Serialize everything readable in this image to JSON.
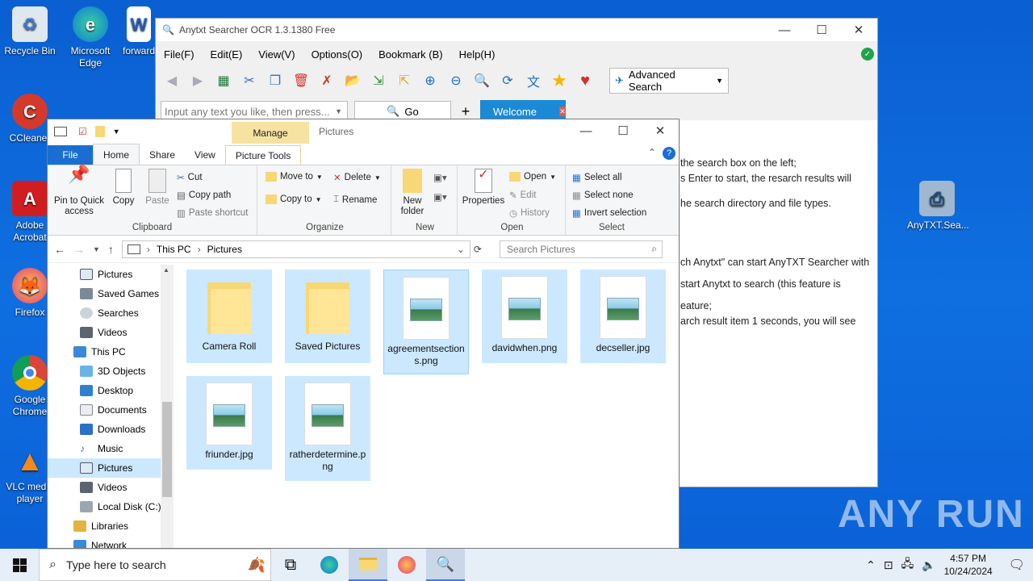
{
  "desktop": {
    "icons": [
      {
        "label": "Recycle Bin"
      },
      {
        "label": "Microsoft Edge"
      },
      {
        "label": "forward"
      },
      {
        "label": "CCleaner"
      },
      {
        "label": "Adobe Acrobat"
      },
      {
        "label": "Firefox"
      },
      {
        "label": "Google Chrome"
      },
      {
        "label": "VLC media player"
      },
      {
        "label": "AnyTXT.Sea..."
      }
    ]
  },
  "anytxt": {
    "title": "Anytxt Searcher OCR 1.3.1380 Free",
    "menu": [
      "File(F)",
      "Edit(E)",
      "View(V)",
      "Options(O)",
      "Bookmark (B)",
      "Help(H)"
    ],
    "advanced_search": "Advanced Search",
    "search_placeholder": "Input any text you like, then press...",
    "go_label": "Go",
    "add_tab": "+",
    "welcome_tab": "Welcome",
    "content_lines": [
      "the search box on the left;",
      "s Enter to start, the resarch results will",
      "",
      "he search directory and file types.",
      "",
      "",
      "",
      "ch Anytxt\" can start AnyTXT Searcher with",
      "",
      " start Anytxt to search (this feature is",
      "",
      "eature;",
      "arch result item 1 seconds, you will see"
    ]
  },
  "explorer": {
    "manage_tab": "Manage",
    "title": "Pictures",
    "tabs": [
      "File",
      "Home",
      "Share",
      "View",
      "Picture Tools"
    ],
    "ribbon": {
      "clipboard": {
        "pin": "Pin to Quick access",
        "copy": "Copy",
        "paste": "Paste",
        "cut": "Cut",
        "copy_path": "Copy path",
        "paste_shortcut": "Paste shortcut",
        "label": "Clipboard"
      },
      "organize": {
        "move_to": "Move to",
        "copy_to": "Copy to",
        "delete": "Delete",
        "rename": "Rename",
        "label": "Organize"
      },
      "new": {
        "new_folder": "New folder",
        "label": "New"
      },
      "open": {
        "properties": "Properties",
        "open": "Open",
        "edit": "Edit",
        "history": "History",
        "label": "Open"
      },
      "select": {
        "select_all": "Select all",
        "select_none": "Select none",
        "invert": "Invert selection",
        "label": "Select"
      }
    },
    "address": {
      "this_pc": "This PC",
      "pictures": "Pictures",
      "search_placeholder": "Search Pictures"
    },
    "nav": [
      "Pictures",
      "Saved Games",
      "Searches",
      "Videos",
      "This PC",
      "3D Objects",
      "Desktop",
      "Documents",
      "Downloads",
      "Music",
      "Pictures",
      "Videos",
      "Local Disk (C:)",
      "Libraries",
      "Network"
    ],
    "files": [
      {
        "name": "Camera Roll",
        "type": "folder"
      },
      {
        "name": "Saved Pictures",
        "type": "folder"
      },
      {
        "name": "agreementsections.png",
        "type": "image"
      },
      {
        "name": "davidwhen.png",
        "type": "image"
      },
      {
        "name": "decseller.jpg",
        "type": "image"
      },
      {
        "name": "friunder.jpg",
        "type": "image"
      },
      {
        "name": "ratherdetermine.png",
        "type": "image"
      }
    ]
  },
  "taskbar": {
    "search_placeholder": "Type here to search",
    "time": "4:57 PM",
    "date": "10/24/2024"
  },
  "watermark": "ANY RUN"
}
